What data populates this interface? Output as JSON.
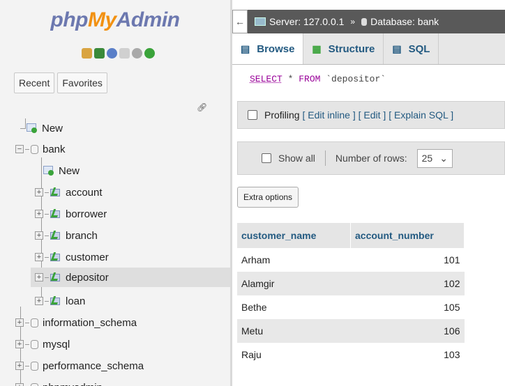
{
  "logo": {
    "php": "php",
    "my": "My",
    "admin": "Admin"
  },
  "nav_tabs": {
    "recent": "Recent",
    "favorites": "Favorites"
  },
  "tree": {
    "new_top": "New",
    "bank": "bank",
    "bank_new": "New",
    "tables": [
      "account",
      "borrower",
      "branch",
      "customer",
      "depositor",
      "loan"
    ],
    "databases": [
      "information_schema",
      "mysql",
      "performance_schema",
      "phpmyadmin"
    ],
    "highlighted_table": "depositor"
  },
  "breadcrumb": {
    "server": "Server: 127.0.0.1",
    "database": "Database: bank"
  },
  "content_tabs": {
    "browse": "Browse",
    "structure": "Structure",
    "sql": "SQL"
  },
  "query": {
    "select": "SELECT",
    "star": " * ",
    "from": "FROM",
    "table": " `depositor`"
  },
  "profiling": {
    "label": "Profiling",
    "edit_inline": "[ Edit inline ]",
    "edit": "[ Edit ]",
    "explain": "[ Explain SQL ]"
  },
  "rows_bar": {
    "show_all": "Show all",
    "number_of_rows": "Number of rows:",
    "rows_value": "25"
  },
  "extra_options": "Extra options",
  "table": {
    "headers": [
      "customer_name",
      "account_number"
    ],
    "rows": [
      [
        "Arham",
        "101"
      ],
      [
        "Alamgir",
        "102"
      ],
      [
        "Bethe",
        "105"
      ],
      [
        "Metu",
        "106"
      ],
      [
        "Raju",
        "103"
      ]
    ]
  },
  "colors": {
    "link": "#235a81",
    "logo_blue": "#6c78af",
    "logo_orange": "#f29111",
    "highlight": "#dedede"
  }
}
